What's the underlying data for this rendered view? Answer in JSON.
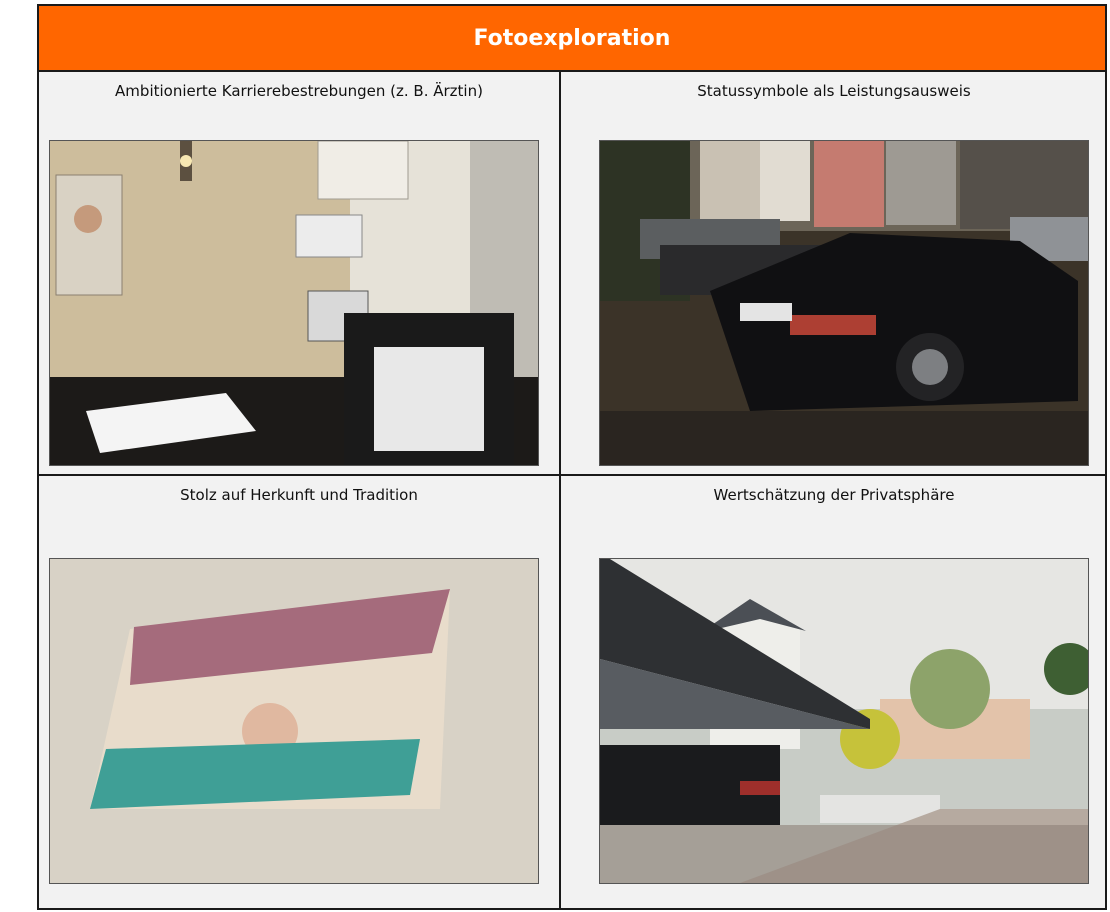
{
  "header": {
    "title": "Fotoexploration"
  },
  "panels": [
    {
      "caption": "Ambitionierte Karrierebestrebungen (z. B. Ärztin)",
      "photo_icon": "doctor-office-photo"
    },
    {
      "caption": "Statussymbole als Leistungsausweis",
      "photo_icon": "parked-cars-photo"
    },
    {
      "caption": "Stolz auf Herkunft und Tradition",
      "photo_icon": "flag-photo"
    },
    {
      "caption": "Wertschätzung der Privatsphäre",
      "photo_icon": "house-carport-photo"
    }
  ],
  "colors": {
    "accent": "#ff6600",
    "border": "#1a1a1a",
    "panel_bg": "#f2f2f2"
  }
}
